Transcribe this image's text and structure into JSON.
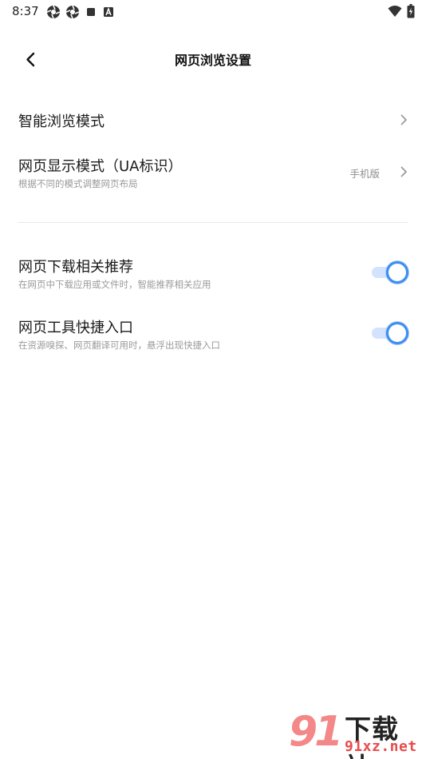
{
  "status_bar": {
    "time": "8:37",
    "left_icons": [
      "aperture-icon",
      "aperture-icon",
      "square-icon",
      "font-a-icon"
    ],
    "right_icons": [
      "wifi-icon",
      "battery-charging-icon"
    ]
  },
  "header": {
    "title": "网页浏览设置"
  },
  "settings": {
    "smart_browse": {
      "title": "智能浏览模式"
    },
    "ua_mode": {
      "title": "网页显示模式（UA标识）",
      "subtitle": "根据不同的模式调整网页布局",
      "value": "手机版"
    },
    "download_recommend": {
      "title": "网页下载相关推荐",
      "subtitle": "在网页中下载应用或文件时，智能推荐相关应用",
      "enabled": true
    },
    "tool_shortcut": {
      "title": "网页工具快捷入口",
      "subtitle": "在资源嗅探、网页翻译可用时，悬浮出现快捷入口",
      "enabled": true
    }
  },
  "colors": {
    "accent": "#3c8ef0",
    "toggle_track": "#d3e3fd",
    "divider": "#e8e8e8"
  },
  "watermark": {
    "text_top": "下载站",
    "text_bottom": "91xz.net"
  }
}
